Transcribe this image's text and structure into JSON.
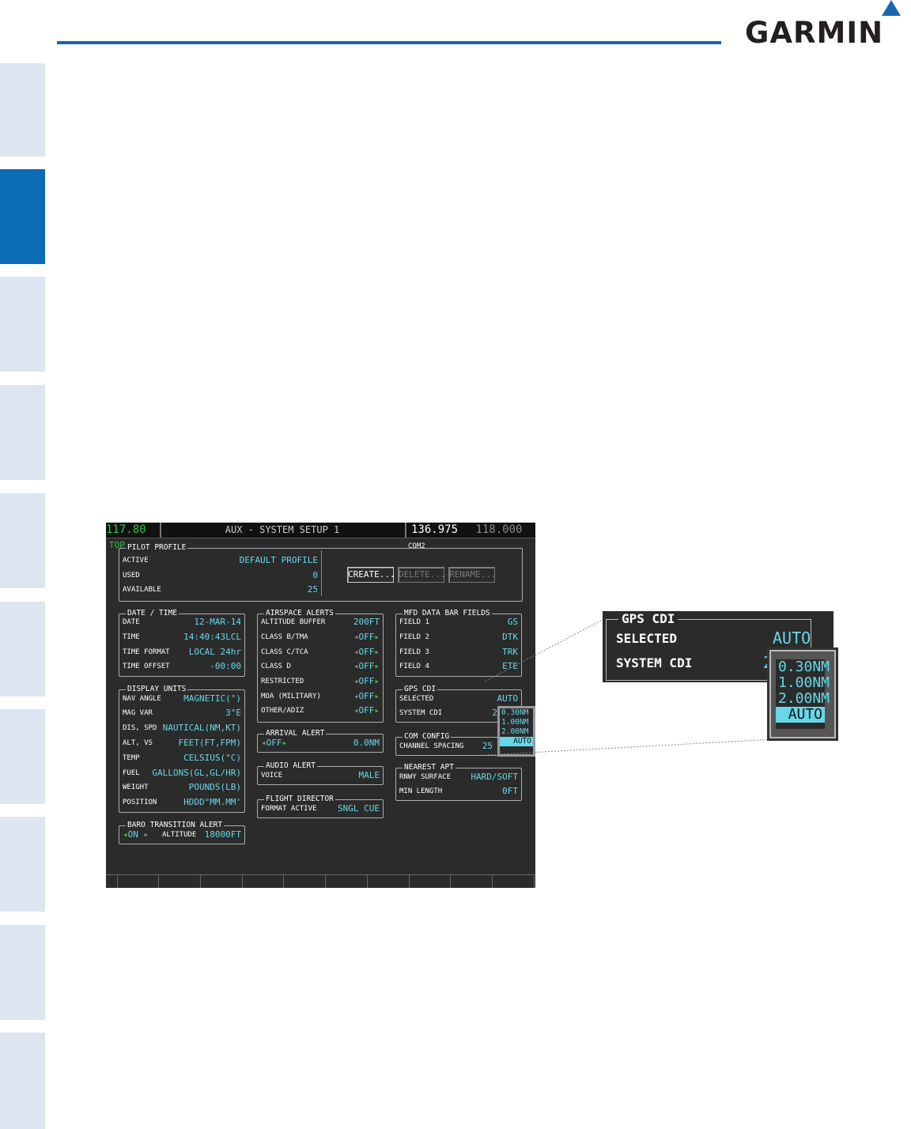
{
  "brand": {
    "logo_text": "GARMIN"
  },
  "mfd": {
    "top_bar": {
      "nav_freq": "117.80",
      "nav_id": "TOP",
      "page_title": "AUX - SYSTEM SETUP 1",
      "com_active": "136.975",
      "com_standby": "118.000",
      "com_label": "COM2"
    },
    "pilot_profile": {
      "title": "PILOT PROFILE",
      "rows": [
        {
          "label": "ACTIVE",
          "value": "DEFAULT PROFILE"
        },
        {
          "label": "USED",
          "value": "0"
        },
        {
          "label": "AVAILABLE",
          "value": "25"
        }
      ],
      "buttons": {
        "create": "CREATE...",
        "delete": "DELETE...",
        "rename": "RENAME..."
      }
    },
    "date_time": {
      "title": "DATE / TIME",
      "rows": [
        {
          "label": "DATE",
          "value": "12-MAR-14"
        },
        {
          "label": "TIME",
          "value": "14:40:43LCL"
        },
        {
          "label": "TIME FORMAT",
          "value": "LOCAL 24hr"
        },
        {
          "label": "TIME OFFSET",
          "value": "-00:00"
        }
      ]
    },
    "display_units": {
      "title": "DISPLAY UNITS",
      "rows": [
        {
          "label": "NAV ANGLE",
          "value": "MAGNETIC(°)"
        },
        {
          "label": "MAG VAR",
          "value": "3°E"
        },
        {
          "label": "DIS, SPD",
          "value": "NAUTICAL(NM,KT)"
        },
        {
          "label": "ALT, VS",
          "value": "FEET(FT,FPM)"
        },
        {
          "label": "TEMP",
          "value": "CELSIUS(°C)"
        },
        {
          "label": "FUEL",
          "value": "GALLONS(GL,GL/HR)"
        },
        {
          "label": "WEIGHT",
          "value": "POUNDS(LB)"
        },
        {
          "label": "POSITION",
          "value": "HDDD°MM.MM'"
        }
      ]
    },
    "baro_alert": {
      "title": "BARO TRANSITION ALERT",
      "state": "ON",
      "label": "ALTITUDE",
      "value": "18000FT"
    },
    "airspace_alerts": {
      "title": "AIRSPACE ALERTS",
      "rows": [
        {
          "label": "ALTITUDE BUFFER",
          "value": "200FT"
        },
        {
          "label": "CLASS B/TMA",
          "value": "OFF"
        },
        {
          "label": "CLASS C/TCA",
          "value": "OFF"
        },
        {
          "label": "CLASS D",
          "value": "OFF"
        },
        {
          "label": "RESTRICTED",
          "value": "OFF"
        },
        {
          "label": "MOA (MILITARY)",
          "value": "OFF"
        },
        {
          "label": "OTHER/ADIZ",
          "value": "OFF"
        }
      ]
    },
    "arrival_alert": {
      "title": "ARRIVAL ALERT",
      "state": "OFF",
      "value": "0.0NM"
    },
    "audio_alert": {
      "title": "AUDIO ALERT",
      "label": "VOICE",
      "value": "MALE"
    },
    "flight_director": {
      "title": "FLIGHT DIRECTOR",
      "label": "FORMAT ACTIVE",
      "value": "SNGL CUE"
    },
    "mfd_data_bar": {
      "title": "MFD DATA BAR FIELDS",
      "rows": [
        {
          "label": "FIELD 1",
          "value": "GS"
        },
        {
          "label": "FIELD 2",
          "value": "DTK"
        },
        {
          "label": "FIELD 3",
          "value": "TRK"
        },
        {
          "label": "FIELD 4",
          "value": "ETE"
        }
      ]
    },
    "gps_cdi": {
      "title": "GPS CDI",
      "selected_label": "SELECTED",
      "selected_value": "AUTO",
      "system_label": "SYSTEM CDI",
      "system_value": "2",
      "options": [
        "0.30NM",
        "1.00NM",
        "2.00NM",
        "AUTO"
      ]
    },
    "com_config": {
      "title": "COM CONFIG",
      "label": "CHANNEL SPACING",
      "value": "25"
    },
    "nearest_apt": {
      "title": "NEAREST APT",
      "rows": [
        {
          "label": "RNWY SURFACE",
          "value": "HARD/SOFT"
        },
        {
          "label": "MIN LENGTH",
          "value": "0FT"
        }
      ]
    }
  },
  "zoom": {
    "title": "GPS CDI",
    "selected_label": "SELECTED",
    "selected_value": "AUTO",
    "system_label": "SYSTEM CDI",
    "system_value": "2",
    "options": [
      "0.30NM",
      "1.00NM",
      "2.00NM",
      "AUTO"
    ]
  },
  "colors": {
    "brand_blue": "#1a67b0",
    "tab_active": "#0b6bb5",
    "tab_inactive": "#dde5f1",
    "mfd_cyan": "#66d8e8",
    "mfd_green": "#31c24a"
  }
}
